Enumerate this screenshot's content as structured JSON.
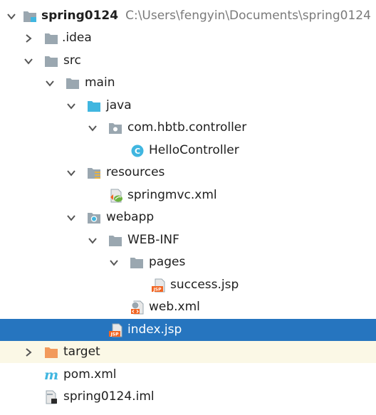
{
  "tree": {
    "root": {
      "name": "spring0124",
      "path": "C:\\Users\\fengyin\\Documents\\spring0124"
    },
    "idea": "idea",
    "src": "src",
    "main": "main",
    "java": "java",
    "package": "com.hbtb.controller",
    "hello_controller": "HelloController",
    "resources": "resources",
    "springmvc_xml": "springmvc.xml",
    "webapp": "webapp",
    "web_inf": "WEB-INF",
    "pages": "pages",
    "success_jsp": "success.jsp",
    "web_xml": "web.xml",
    "index_jsp": "index.jsp",
    "target": "target",
    "pom_xml": "pom.xml",
    "iml": "spring0124.iml"
  },
  "icon_labels": {
    "class": "C",
    "jsp": "JSP"
  },
  "colors": {
    "selection": "#2675bf",
    "excluded_bg": "#fbf8e6",
    "folder": "#9aa7b0",
    "source_folder": "#40b6e0",
    "excluded_folder": "#f29a5c",
    "class_icon": "#40b6e0",
    "jsp_icon": "#f26522"
  }
}
